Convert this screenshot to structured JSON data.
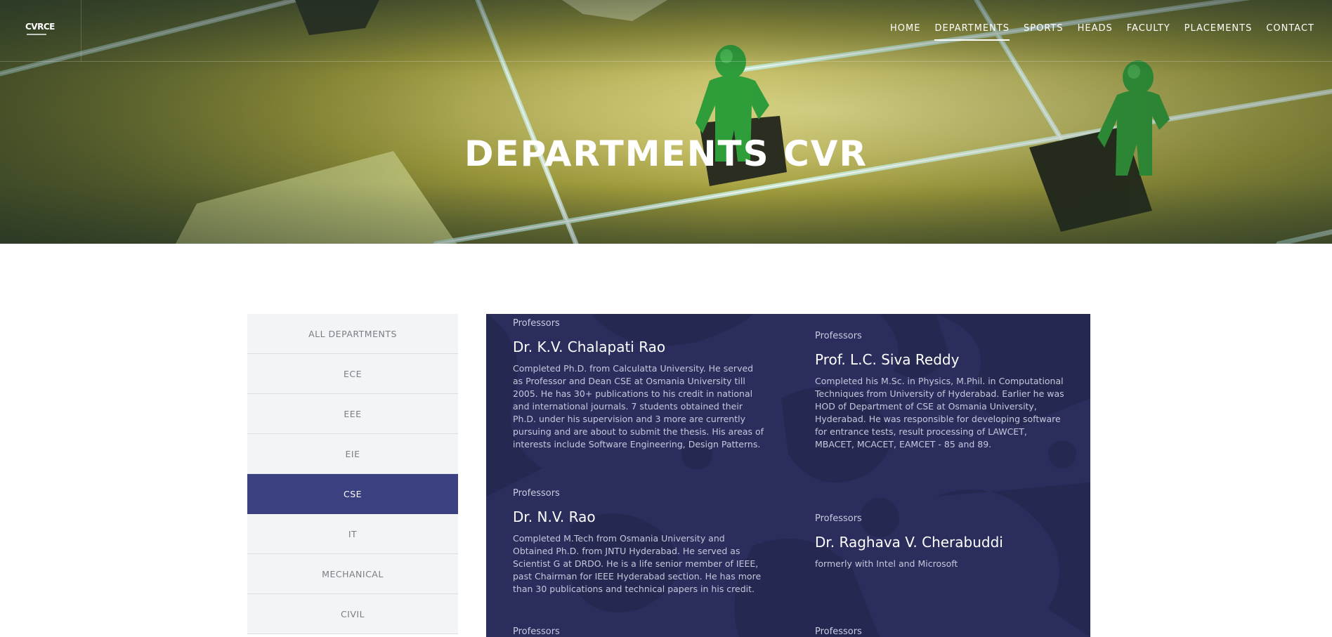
{
  "logo": {
    "text": "CVRCE"
  },
  "nav": {
    "items": [
      {
        "label": "HOME",
        "active": false
      },
      {
        "label": "DEPARTMENTS",
        "active": true
      },
      {
        "label": "SPORTS",
        "active": false
      },
      {
        "label": "HEADS",
        "active": false
      },
      {
        "label": "FACULTY",
        "active": false
      },
      {
        "label": "PLACEMENTS",
        "active": false
      },
      {
        "label": "CONTACT",
        "active": false
      }
    ]
  },
  "hero": {
    "title": "DEPARTMENTS CVR"
  },
  "sidebar": {
    "items": [
      {
        "label": "ALL DEPARTMENTS"
      },
      {
        "label": "ECE"
      },
      {
        "label": "EEE"
      },
      {
        "label": "EIE"
      },
      {
        "label": "CSE"
      },
      {
        "label": "IT"
      },
      {
        "label": "MECHANICAL"
      },
      {
        "label": "CIVIL"
      }
    ],
    "active": "CSE"
  },
  "faculty": [
    {
      "role": "Professors",
      "name": "Dr. K.V. Chalapati Rao",
      "bio": "Completed Ph.D. from Calculatta University. He served as Professor and Dean CSE at Osmania University till 2005. He has 30+ publications to his credit in national and international journals. 7 students obtained their Ph.D. under his supervision and 3 more are currently pursuing and are about to submit the thesis. His areas of interests include Software Engineering, Design Patterns."
    },
    {
      "role": "Professors",
      "name": "Prof. L.C. Siva Reddy",
      "bio": "Completed his M.Sc. in Physics, M.Phil. in Computational Techniques from University of Hyderabad. Earlier he was HOD of Department of CSE at Osmania University, Hyderabad. He was responsible for developing software for entrance tests, result processing of LAWCET, MBACET, MCACET, EAMCET - 85 and 89."
    },
    {
      "role": "Professors",
      "name": "Dr. N.V. Rao",
      "bio": "Completed M.Tech from Osmania University and Obtained Ph.D. from JNTU Hyderabad. He served as Scientist G at DRDO. He is a life senior member of IEEE, past Chairman for IEEE Hyderabad section. He has more than 30 publications and technical papers in his credit."
    },
    {
      "role": "Professors",
      "name": "Dr. Raghava V. Cherabuddi",
      "bio": "formerly with Intel and Microsoft"
    },
    {
      "role": "Professors",
      "name": "",
      "bio": ""
    },
    {
      "role": "Professors",
      "name": "",
      "bio": ""
    }
  ],
  "colors": {
    "accent": "#3b4080",
    "panel": "#2b2d5c"
  }
}
